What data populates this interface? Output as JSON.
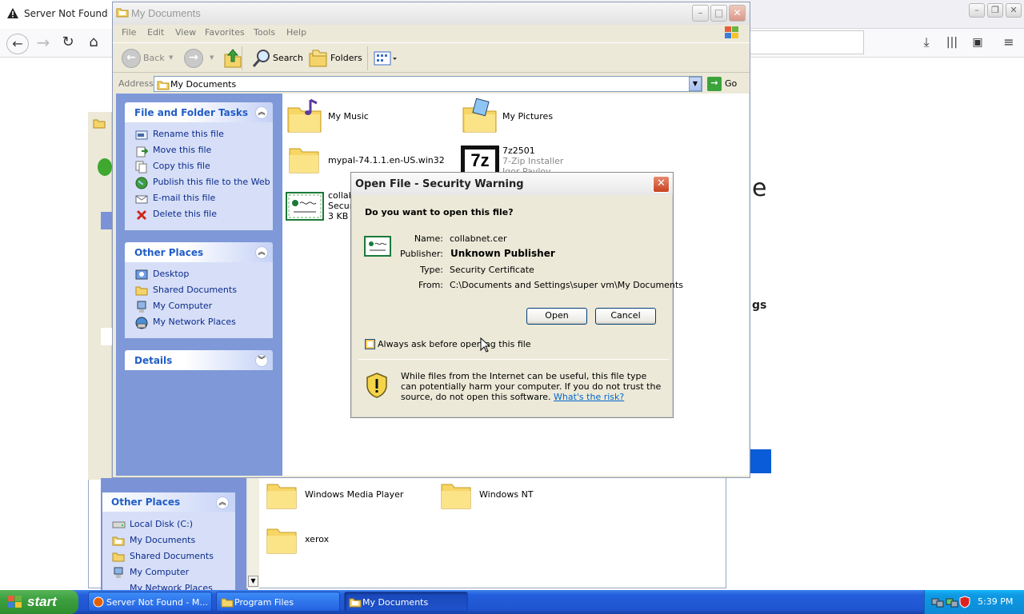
{
  "firefox": {
    "tab_title": "Server Not Found",
    "partial_heading": "e",
    "partial_text": "gs"
  },
  "program_files": {
    "other_places_title": "Other Places",
    "other_places_items": [
      "Local Disk (C:)",
      "My Documents",
      "Shared Documents",
      "My Computer",
      "My Network Places"
    ],
    "folders": [
      "Windows Media Player",
      "Windows NT",
      "xerox"
    ]
  },
  "my_documents": {
    "title": "My Documents",
    "menu": [
      "File",
      "Edit",
      "View",
      "Favorites",
      "Tools",
      "Help"
    ],
    "toolbar": {
      "back": "Back",
      "search": "Search",
      "folders": "Folders"
    },
    "address_label": "Address",
    "address_value": "My Documents",
    "go_label": "Go",
    "file_tasks": {
      "title": "File and Folder Tasks",
      "items": [
        "Rename this file",
        "Move this file",
        "Copy this file",
        "Publish this file to the Web",
        "E-mail this file",
        "Delete this file"
      ]
    },
    "other_places": {
      "title": "Other Places",
      "items": [
        "Desktop",
        "Shared Documents",
        "My Computer",
        "My Network Places"
      ]
    },
    "details_title": "Details",
    "items": {
      "my_music": "My Music",
      "my_pictures": "My Pictures",
      "mypal": "mypal-74.1.1.en-US.win32",
      "sevenzip_name": "7z2501",
      "sevenzip_desc": "7-Zip Installer",
      "sevenzip_author": "Igor Pavlov",
      "collab_name": "collab",
      "collab_type": "Secur",
      "collab_size": "3 KB"
    }
  },
  "dialog": {
    "title": "Open File - Security Warning",
    "question": "Do you want to open this file?",
    "name_label": "Name:",
    "name_value": "collabnet.cer",
    "publisher_label": "Publisher:",
    "publisher_value": "Unknown Publisher",
    "type_label": "Type:",
    "type_value": "Security Certificate",
    "from_label": "From:",
    "from_value": "C:\\Documents and Settings\\super vm\\My Documents",
    "open_button": "Open",
    "cancel_button": "Cancel",
    "checkbox_label": "Always ask before opening this file",
    "checkbox_checked": false,
    "warning_text": "While files from the Internet can be useful, this file type can potentially harm your computer. If you do not trust the source, do not open this software.",
    "risk_link": "What's the risk?"
  },
  "taskbar": {
    "start": "start",
    "buttons": [
      "Server Not Found - M...",
      "Program Files",
      "My Documents"
    ],
    "clock": "5:39 PM"
  }
}
